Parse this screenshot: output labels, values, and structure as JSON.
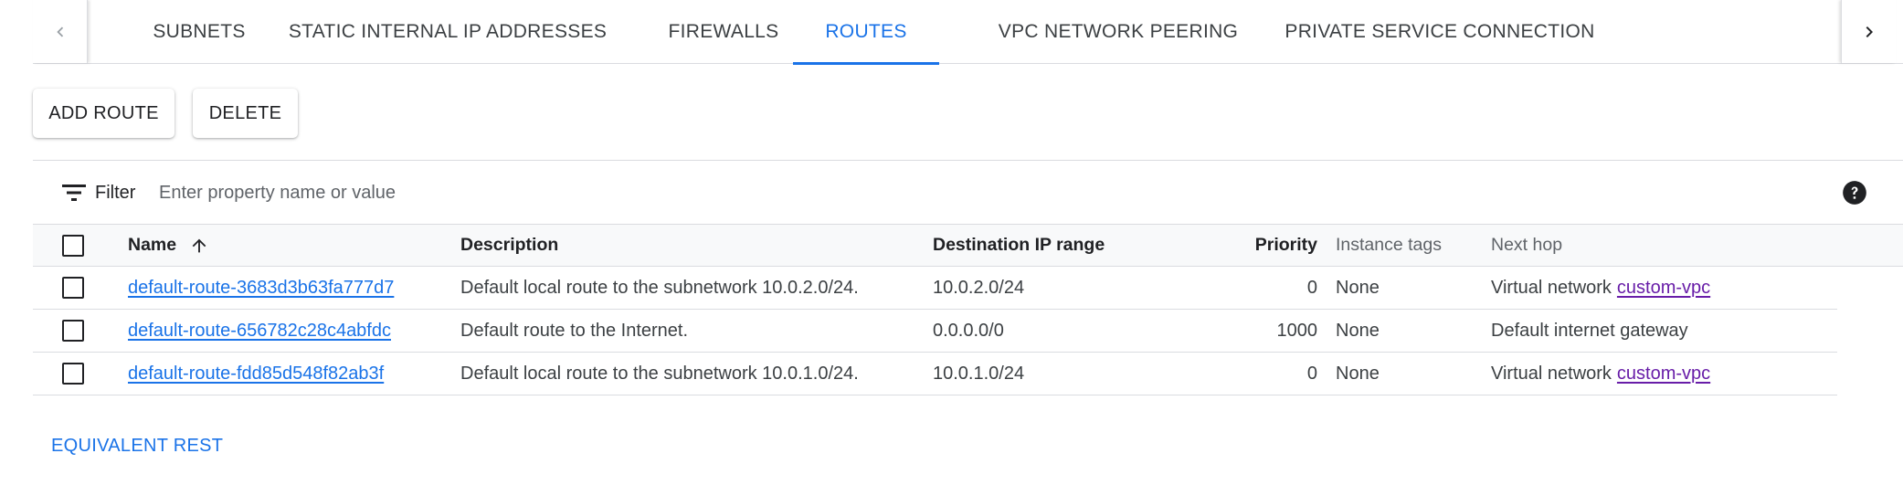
{
  "tabs": [
    {
      "label": "SUBNETS",
      "active": false
    },
    {
      "label": "STATIC INTERNAL IP ADDRESSES",
      "active": false
    },
    {
      "label": "FIREWALLS",
      "active": false
    },
    {
      "label": "ROUTES",
      "active": true
    },
    {
      "label": "VPC NETWORK PEERING",
      "active": false
    },
    {
      "label": "PRIVATE SERVICE CONNECTION",
      "active": false
    }
  ],
  "tab_nav": {
    "left_icon": "chevron-left-icon",
    "right_icon": "chevron-right-icon"
  },
  "actions": {
    "add_route": "ADD ROUTE",
    "delete": "DELETE"
  },
  "filter": {
    "label": "Filter",
    "placeholder": "Enter property name or value",
    "icon": "filter-list-icon",
    "help_icon": "help-icon"
  },
  "table": {
    "headers": {
      "name": "Name",
      "description": "Description",
      "destination": "Destination IP range",
      "priority": "Priority",
      "instance_tags": "Instance tags",
      "next_hop": "Next hop"
    },
    "sort": {
      "column": "name",
      "direction": "ascending",
      "icon": "arrow-upward-icon"
    },
    "rows": [
      {
        "name": "default-route-3683d3b63fa777d7",
        "description": "Default local route to the subnetwork 10.0.2.0/24.",
        "destination": "10.0.2.0/24",
        "priority": "0",
        "instance_tags": "None",
        "next_hop_text": "Virtual network",
        "next_hop_link": "custom-vpc"
      },
      {
        "name": "default-route-656782c28c4abfdc",
        "description": "Default route to the Internet.",
        "destination": "0.0.0.0/0",
        "priority": "1000",
        "instance_tags": "None",
        "next_hop_text": "Default internet gateway",
        "next_hop_link": ""
      },
      {
        "name": "default-route-fdd85d548f82ab3f",
        "description": "Default local route to the subnetwork 10.0.1.0/24.",
        "destination": "10.0.1.0/24",
        "priority": "0",
        "instance_tags": "None",
        "next_hop_text": "Virtual network",
        "next_hop_link": "custom-vpc"
      }
    ]
  },
  "footer": {
    "equivalent_rest": "EQUIVALENT REST"
  },
  "colors": {
    "accent": "#1a73e8",
    "visited_link": "#681da8",
    "border": "#dadce0",
    "header_bg": "#f8f9fa"
  }
}
